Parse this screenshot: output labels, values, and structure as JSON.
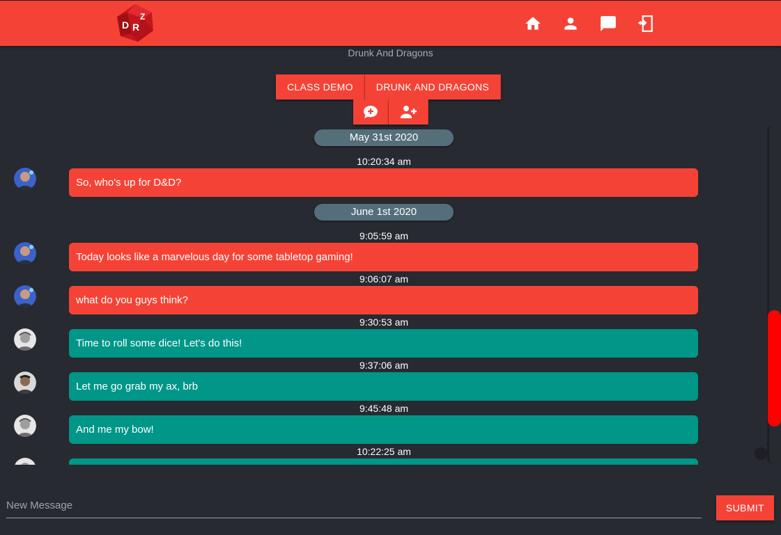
{
  "header": {
    "logo_letters": [
      "D",
      "R",
      "Z"
    ],
    "nav": [
      {
        "icon": "home-icon"
      },
      {
        "icon": "user-icon"
      },
      {
        "icon": "chat-icon"
      },
      {
        "icon": "logout-icon"
      }
    ]
  },
  "group": {
    "title": "Drunk And Dragons",
    "tabs": [
      {
        "label": "Class Demo"
      },
      {
        "label": "Drunk And Dragons"
      }
    ],
    "actions": [
      {
        "icon": "new-chat-icon"
      },
      {
        "icon": "add-user-icon"
      }
    ]
  },
  "chat": {
    "dates": [
      "May 31st 2020",
      "June 1st 2020"
    ],
    "messages": [
      {
        "time": "10:20:34 am",
        "text": "So, who's up for D&D?",
        "color": "red",
        "avatar": "avatar-user-1"
      },
      {
        "time": "9:05:59 am",
        "text": "Today looks like a marvelous day for some tabletop gaming!",
        "color": "red",
        "avatar": "avatar-user-1"
      },
      {
        "time": "9:06:07 am",
        "text": "what do you guys think?",
        "color": "red",
        "avatar": "avatar-user-1"
      },
      {
        "time": "9:30:53 am",
        "text": "Time to roll some dice! Let's do this!",
        "color": "teal",
        "avatar": "avatar-user-2"
      },
      {
        "time": "9:37:06 am",
        "text": "Let me go grab my ax, brb",
        "color": "teal",
        "avatar": "avatar-user-3"
      },
      {
        "time": "9:45:48 am",
        "text": "And me my bow!",
        "color": "teal",
        "avatar": "avatar-user-2"
      },
      {
        "time": "10:22:25 am",
        "text": "",
        "color": "teal",
        "avatar": "avatar-user-2"
      }
    ]
  },
  "composer": {
    "placeholder": "New Message",
    "submit_label": "Submit"
  },
  "colors": {
    "primary": "#f44336",
    "secondary": "#009688",
    "background": "#272a31",
    "date_pill": "#546e7a"
  }
}
